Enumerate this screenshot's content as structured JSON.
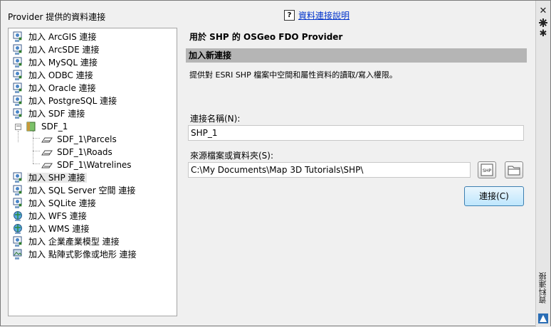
{
  "provider_panel": {
    "title": "Provider 提供的資料連接",
    "items": [
      {
        "label": "加入 ArcGIS 連接",
        "icon": "add-connection-icon"
      },
      {
        "label": "加入 ArcSDE 連接",
        "icon": "add-connection-icon"
      },
      {
        "label": "加入 MySQL 連接",
        "icon": "add-connection-icon"
      },
      {
        "label": "加入 ODBC 連接",
        "icon": "add-connection-icon"
      },
      {
        "label": "加入 Oracle 連接",
        "icon": "add-connection-icon"
      },
      {
        "label": "加入 PostgreSQL 連接",
        "icon": "add-connection-icon"
      },
      {
        "label": "加入 SDF 連接",
        "icon": "add-connection-icon"
      },
      {
        "label": "SDF_1",
        "icon": "datastore-icon"
      },
      {
        "label": "SDF_1\\Parcels",
        "icon": "feature-layer-icon"
      },
      {
        "label": "SDF_1\\Roads",
        "icon": "feature-layer-icon"
      },
      {
        "label": "SDF_1\\Watrelines",
        "icon": "feature-layer-icon"
      },
      {
        "label": "加入 SHP 連接",
        "icon": "add-connection-icon"
      },
      {
        "label": "加入 SQL Server 空間 連接",
        "icon": "add-connection-icon"
      },
      {
        "label": "加入 SQLite 連接",
        "icon": "add-connection-icon"
      },
      {
        "label": "加入 WFS 連接",
        "icon": "globe-connection-icon"
      },
      {
        "label": "加入 WMS 連接",
        "icon": "globe-connection-icon"
      },
      {
        "label": "加入 企業產業模型 連接",
        "icon": "add-connection-icon"
      },
      {
        "label": "加入 點陣式影像或地形 連接",
        "icon": "raster-connection-icon"
      }
    ],
    "selected_index": 11
  },
  "help": {
    "icon": "?",
    "link_text": "資料連接說明"
  },
  "main": {
    "heading": "用於 SHP 的 OSGeo FDO Provider",
    "section_title": "加入新連接",
    "description": "提供對 ESRI SHP 檔案中空間和屬性資料的讀取/寫入權限。",
    "connection_name_label": "連接名稱(N):",
    "connection_name_value": "SHP_1",
    "source_label": "來源檔案或資料夾(S):",
    "source_value": "C:\\My Documents\\Map 3D Tutorials\\SHP\\",
    "shp_button_text": "SHP",
    "connect_button": "連接(C)"
  },
  "palette_strip": {
    "close_icon": "✕",
    "settings_icon": "✱",
    "title": "資料連接"
  },
  "colors": {
    "link": "#0033cc",
    "section_bar": "#b5b5b5",
    "primary_button_border": "#3c7fb1"
  }
}
